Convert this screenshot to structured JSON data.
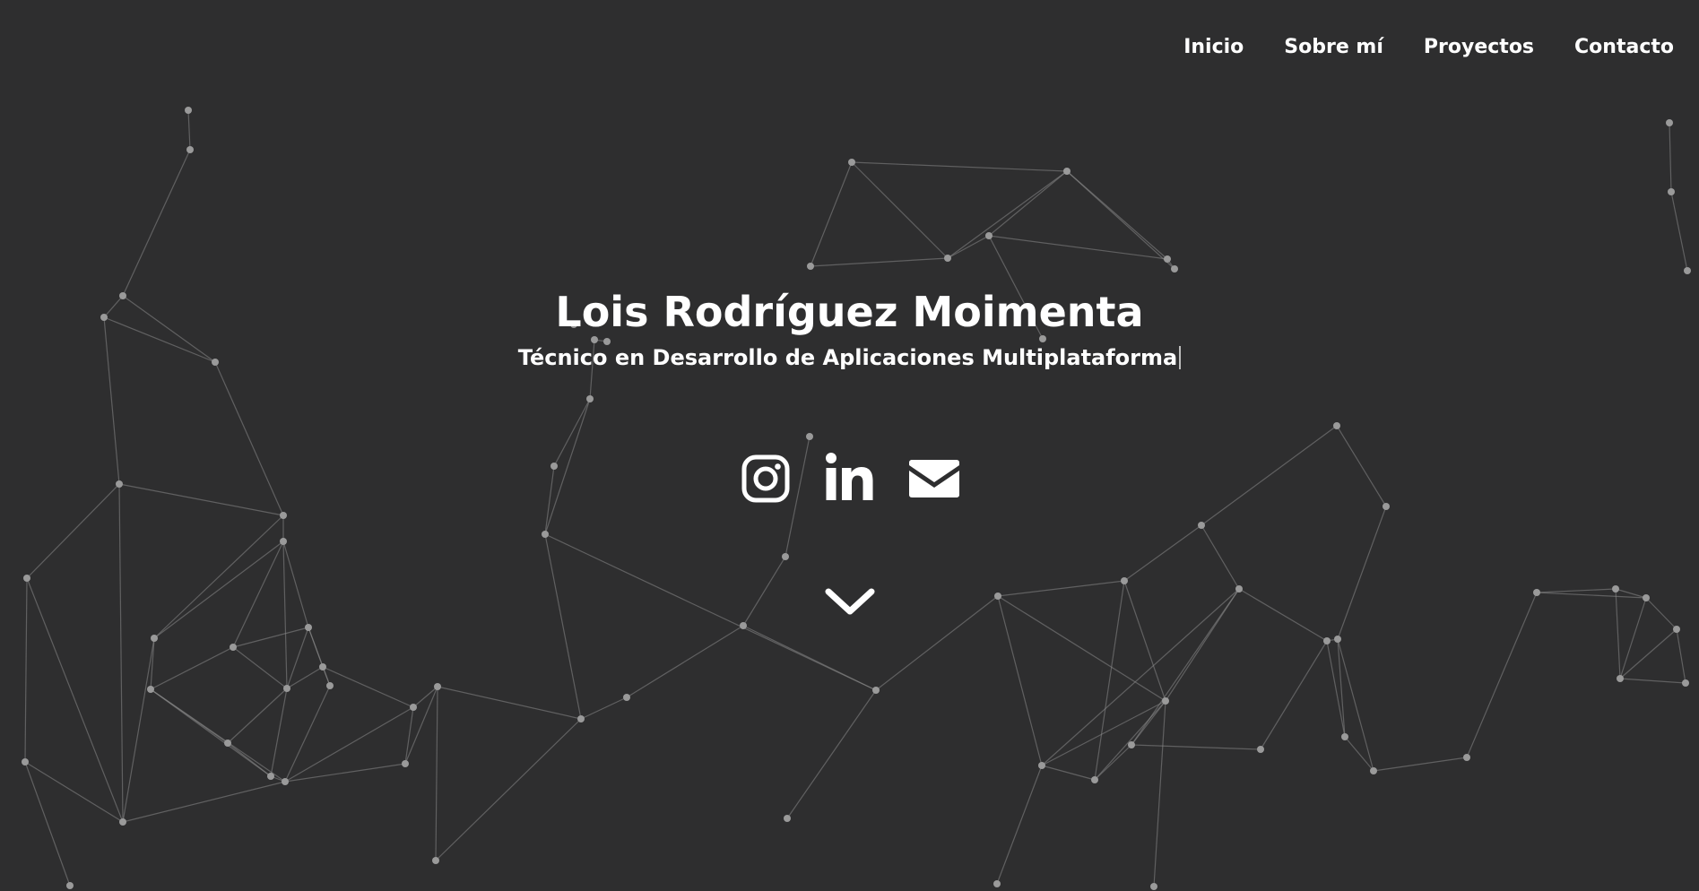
{
  "nav": {
    "items": [
      {
        "label": "Inicio"
      },
      {
        "label": "Sobre mí"
      },
      {
        "label": "Proyectos"
      },
      {
        "label": "Contacto"
      }
    ]
  },
  "hero": {
    "title": "Lois Rodríguez Moimenta",
    "subtitle": "Técnico en Desarrollo de Aplicaciones Multiplataforma"
  },
  "socials": [
    {
      "icon": "instagram-icon"
    },
    {
      "icon": "linkedin-icon"
    },
    {
      "icon": "envelope-icon"
    }
  ],
  "scroll": {
    "icon": "chevron-down-icon"
  },
  "colors": {
    "background": "#2e2e2f",
    "text": "#ffffff",
    "network": "#9a9a9a"
  }
}
